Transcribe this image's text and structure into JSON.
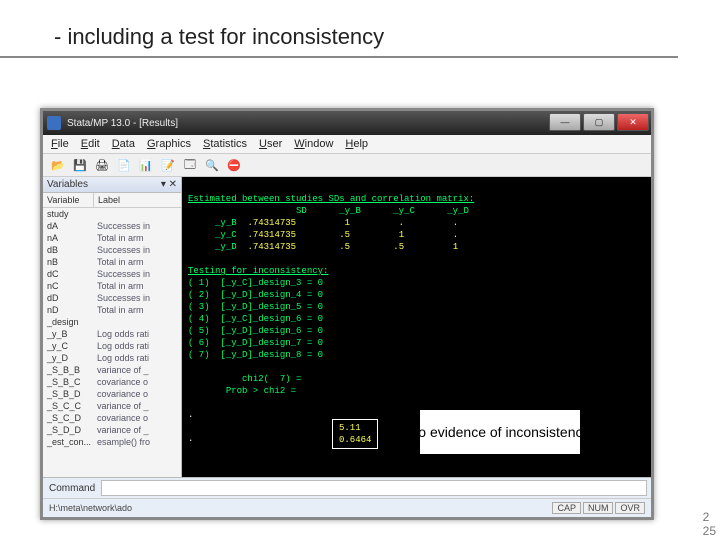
{
  "slide": {
    "title": "- including a test for inconsistency",
    "annotation": "no evidence of inconsistency",
    "page_number_small": "2",
    "page_number": "25"
  },
  "window": {
    "title": "Stata/MP 13.0 - [Results]",
    "menu": [
      "File",
      "Edit",
      "Data",
      "Graphics",
      "Statistics",
      "User",
      "Window",
      "Help"
    ]
  },
  "sidebar": {
    "title": "Variables",
    "col_variable": "Variable",
    "col_label": "Label",
    "rows": [
      {
        "name": "study",
        "label": ""
      },
      {
        "name": "dA",
        "label": "Successes in"
      },
      {
        "name": "nA",
        "label": "Total in arm"
      },
      {
        "name": "dB",
        "label": "Successes in"
      },
      {
        "name": "nB",
        "label": "Total in arm"
      },
      {
        "name": "dC",
        "label": "Successes in"
      },
      {
        "name": "nC",
        "label": "Total in arm"
      },
      {
        "name": "dD",
        "label": "Successes in"
      },
      {
        "name": "nD",
        "label": "Total in arm"
      },
      {
        "name": "_design",
        "label": ""
      },
      {
        "name": "_y_B",
        "label": "Log odds rati"
      },
      {
        "name": "_y_C",
        "label": "Log odds rati"
      },
      {
        "name": "_y_D",
        "label": "Log odds rati"
      },
      {
        "name": "_S_B_B",
        "label": "variance of _"
      },
      {
        "name": "_S_B_C",
        "label": "covariance o"
      },
      {
        "name": "_S_B_D",
        "label": "covariance o"
      },
      {
        "name": "_S_C_C",
        "label": "variance of _"
      },
      {
        "name": "_S_C_D",
        "label": "covariance o"
      },
      {
        "name": "_S_D_D",
        "label": "variance of _"
      },
      {
        "name": "_est_con...",
        "label": "esample() fro"
      }
    ]
  },
  "results": {
    "header": "Estimated between studies SDs and correlation matrix:",
    "col_sd": "SD",
    "col_yb": "_y_B",
    "col_yc": "_y_C",
    "col_yd": "_y_D",
    "matrix_rows": [
      {
        "label": "_y_B",
        "sd": ".74314735",
        "a": "1",
        "b": ".",
        "c": "."
      },
      {
        "label": "_y_C",
        "sd": ".74314735",
        "a": ".5",
        "b": "1",
        "c": "."
      },
      {
        "label": "_y_D",
        "sd": ".74314735",
        "a": ".5",
        "b": ".5",
        "c": "1"
      }
    ],
    "test_header": "Testing for inconsistency:",
    "tests": [
      "( 1)  [_y_C]_design_3 = 0",
      "( 2)  [_y_D]_design_4 = 0",
      "( 3)  [_y_D]_design_5 = 0",
      "( 4)  [_y_C]_design_6 = 0",
      "( 5)  [_y_D]_design_6 = 0",
      "( 6)  [_y_D]_design_7 = 0",
      "( 7)  [_y_D]_design_8 = 0"
    ],
    "chi2_label": "chi2(  7) =",
    "chi2_value": "5.11",
    "prob_label": "Prob > chi2 =",
    "prob_value": "0.6464"
  },
  "command": {
    "label": "Command",
    "value": ""
  },
  "status": {
    "path": "H:\\meta\\network\\ado",
    "cells": [
      "CAP",
      "NUM",
      "OVR"
    ]
  }
}
